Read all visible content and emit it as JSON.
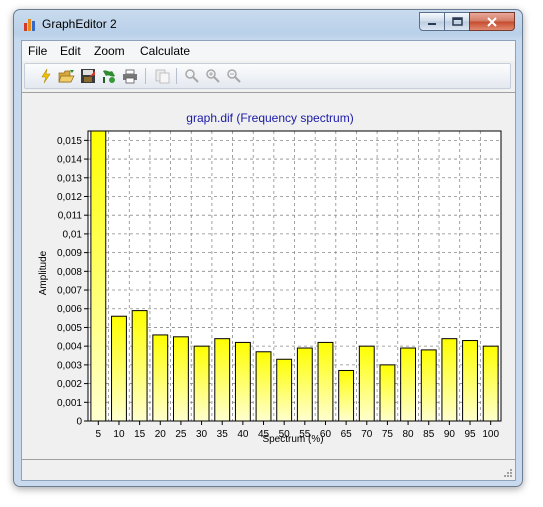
{
  "window": {
    "title": "GraphEditor 2"
  },
  "menu": {
    "items": [
      "File",
      "Edit",
      "Zoom",
      "Calculate"
    ]
  },
  "toolbar": {
    "icons": [
      "new-icon",
      "open-icon",
      "save-icon",
      "export-icon",
      "print-icon",
      "copy-icon",
      "zoom-icon",
      "zoom-in-icon",
      "zoom-out-icon"
    ]
  },
  "chart_data": {
    "type": "bar",
    "title": "graph.dif (Frequency spectrum)",
    "xlabel": "Spectrum (%)",
    "ylabel": "Amplitude",
    "categories": [
      "5",
      "10",
      "15",
      "20",
      "25",
      "30",
      "35",
      "40",
      "45",
      "50",
      "55",
      "60",
      "65",
      "70",
      "75",
      "80",
      "85",
      "90",
      "95",
      "100"
    ],
    "values": [
      0.0155,
      0.0056,
      0.0059,
      0.0046,
      0.0045,
      0.004,
      0.0044,
      0.0042,
      0.0037,
      0.0033,
      0.0039,
      0.0042,
      0.0027,
      0.004,
      0.003,
      0.0039,
      0.0038,
      0.0044,
      0.0043,
      0.004
    ],
    "ylim": [
      0,
      0.0155
    ],
    "yticks": [
      "0",
      "0,001",
      "0,002",
      "0,003",
      "0,004",
      "0,005",
      "0,006",
      "0,007",
      "0,008",
      "0,009",
      "0,01",
      "0,011",
      "0,012",
      "0,013",
      "0,014",
      "0,015"
    ],
    "grid": true,
    "colors": {
      "bar_top": "#ffff00",
      "bar_bottom": "#ffffd0",
      "title": "#1a1aa6"
    }
  }
}
